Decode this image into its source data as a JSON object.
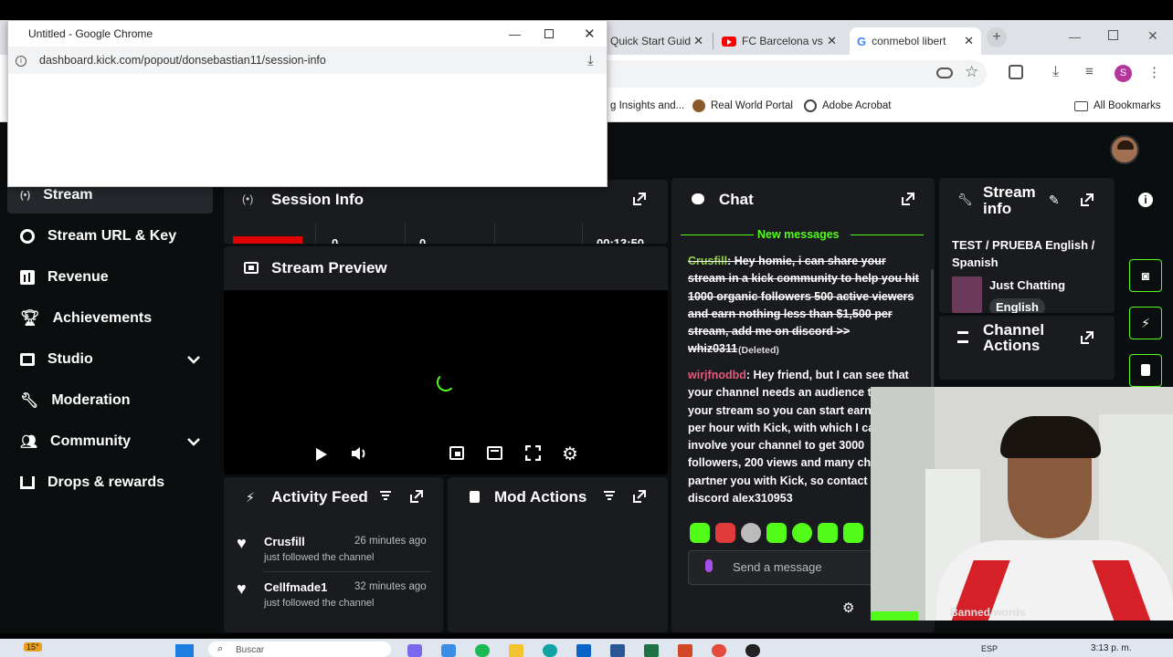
{
  "browser": {
    "tabs": [
      {
        "label": "Quick Start Guid",
        "icon": "page-icon"
      },
      {
        "label": "FC Barcelona vs",
        "icon": "youtube-icon",
        "color": "#ff0000"
      },
      {
        "label": "conmebol libert",
        "icon": "google-icon"
      }
    ],
    "bookmarks": [
      {
        "label": "g Insights and..."
      },
      {
        "label": "Real World Portal"
      },
      {
        "label": "Adobe Acrobat"
      }
    ],
    "all_bookmarks": "All Bookmarks",
    "profile_initial": "S"
  },
  "popup": {
    "title": "Untitled - Google Chrome",
    "url": "dashboard.kick.com/popout/donsebastian11/session-info"
  },
  "sidebar": {
    "items": [
      {
        "label": "Stream",
        "icon": "stream-icon",
        "active": true
      },
      {
        "label": "Stream URL & Key",
        "icon": "link-icon"
      },
      {
        "label": "Revenue",
        "icon": "revenue-icon"
      },
      {
        "label": "Achievements",
        "icon": "trophy-icon"
      },
      {
        "label": "Studio",
        "icon": "studio-icon",
        "expandable": true
      },
      {
        "label": "Moderation",
        "icon": "wrench-icon"
      },
      {
        "label": "Community",
        "icon": "community-icon",
        "expandable": true
      },
      {
        "label": "Drops & rewards",
        "icon": "drops-icon"
      }
    ]
  },
  "session_info": {
    "title": "Session Info",
    "stats": [
      "0",
      "0",
      "00:13:50"
    ]
  },
  "stream_preview": {
    "title": "Stream Preview"
  },
  "activity_feed": {
    "title": "Activity Feed",
    "items": [
      {
        "user": "Crusfill",
        "time": "26 minutes ago",
        "action": "just followed the channel"
      },
      {
        "user": "Cellfmade1",
        "time": "32 minutes ago",
        "action": "just followed the channel"
      }
    ]
  },
  "mod_actions": {
    "title": "Mod Actions"
  },
  "chat": {
    "title": "Chat",
    "new_messages": "New messages",
    "messages": [
      {
        "user": "Crusfill",
        "user_color": "#8fd14f",
        "lines": [
          "Hey homie, i can share your",
          "stream in a kick community to help you hit",
          "1000 organic followers 500 active viewers",
          "and earn nothing less than $1,500 per",
          "stream, add me on discord >>",
          "whiz0311"
        ],
        "deleted_label": "(Deleted)"
      },
      {
        "user": "wirjfnodbd",
        "user_color": "#e05a7a",
        "lines": [
          "Hey friend, but I can see that",
          "your channel needs an audience to",
          "your stream so you can start earni",
          "per hour with Kick, with which I ca",
          "involve your channel to get 3000",
          "followers, 200 views and many cha",
          "partner you with Kick, so contact m",
          "discord alex310953"
        ]
      }
    ],
    "input_placeholder": "Send a message"
  },
  "stream_info": {
    "title_line1": "Stream",
    "title_line2": "info",
    "stream_title": "TEST / PRUEBA English / Spanish",
    "category": "Just Chatting",
    "tag": "English"
  },
  "channel_actions": {
    "title_line1": "Channel",
    "title_line2": "Actions"
  },
  "banned_words": "Banned words",
  "taskbar": {
    "weather": "15°",
    "search": "Buscar",
    "lang": "ESP",
    "time": "3:13 p. m."
  },
  "colors": {
    "kick_green": "#53fc18",
    "panel": "#191b1f",
    "page_bg": "#0b0e0f"
  }
}
